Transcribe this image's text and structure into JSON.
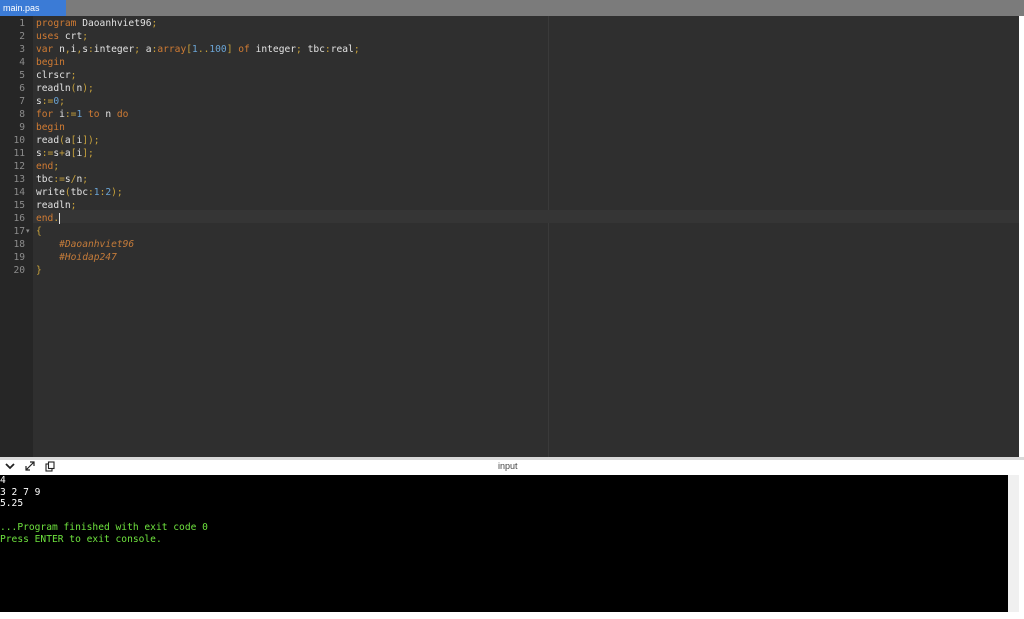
{
  "tab": {
    "label": "main.pas"
  },
  "editor": {
    "line_numbers": [
      "1",
      "2",
      "3",
      "4",
      "5",
      "6",
      "7",
      "8",
      "9",
      "10",
      "11",
      "12",
      "13",
      "14",
      "15",
      "16",
      "17",
      "18",
      "19",
      "20"
    ],
    "fold_marker": "▾",
    "lines": [
      [
        [
          "kw",
          "program "
        ],
        [
          "id",
          "Daoanhviet96"
        ],
        [
          "pu",
          ";"
        ]
      ],
      [
        [
          "kw",
          "uses "
        ],
        [
          "id",
          "crt"
        ],
        [
          "pu",
          ";"
        ]
      ],
      [
        [
          "kw",
          "var "
        ],
        [
          "id",
          "n"
        ],
        [
          "pu",
          ","
        ],
        [
          "id",
          "i"
        ],
        [
          "pu",
          ","
        ],
        [
          "id",
          "s"
        ],
        [
          "pu",
          ":"
        ],
        [
          "id",
          "integer"
        ],
        [
          "pu",
          "; "
        ],
        [
          "id",
          "a"
        ],
        [
          "pu",
          ":"
        ],
        [
          "kw",
          "array"
        ],
        [
          "pu",
          "["
        ],
        [
          "nm",
          "1"
        ],
        [
          "pu",
          ".."
        ],
        [
          "nm",
          "100"
        ],
        [
          "pu",
          "] "
        ],
        [
          "kw",
          "of "
        ],
        [
          "id",
          "integer"
        ],
        [
          "pu",
          "; "
        ],
        [
          "id",
          "tbc"
        ],
        [
          "pu",
          ":"
        ],
        [
          "id",
          "real"
        ],
        [
          "pu",
          ";"
        ]
      ],
      [
        [
          "kw",
          "begin"
        ]
      ],
      [
        [
          "id",
          "clrscr"
        ],
        [
          "pu",
          ";"
        ]
      ],
      [
        [
          "id",
          "readln"
        ],
        [
          "pu",
          "("
        ],
        [
          "id",
          "n"
        ],
        [
          "pu",
          ");"
        ]
      ],
      [
        [
          "id",
          "s"
        ],
        [
          "pu",
          ":="
        ],
        [
          "nm",
          "0"
        ],
        [
          "pu",
          ";"
        ]
      ],
      [
        [
          "kw",
          "for "
        ],
        [
          "id",
          "i"
        ],
        [
          "pu",
          ":="
        ],
        [
          "nm",
          "1"
        ],
        [
          "kw",
          " to "
        ],
        [
          "id",
          "n"
        ],
        [
          "kw",
          " do"
        ]
      ],
      [
        [
          "kw",
          "begin"
        ]
      ],
      [
        [
          "id",
          "read"
        ],
        [
          "pu",
          "("
        ],
        [
          "id",
          "a"
        ],
        [
          "pu",
          "["
        ],
        [
          "id",
          "i"
        ],
        [
          "pu",
          "]);"
        ]
      ],
      [
        [
          "id",
          "s"
        ],
        [
          "pu",
          ":="
        ],
        [
          "id",
          "s"
        ],
        [
          "pu",
          "+"
        ],
        [
          "id",
          "a"
        ],
        [
          "pu",
          "["
        ],
        [
          "id",
          "i"
        ],
        [
          "pu",
          "];"
        ]
      ],
      [
        [
          "kw",
          "end"
        ],
        [
          "pu",
          ";"
        ]
      ],
      [
        [
          "id",
          "tbc"
        ],
        [
          "pu",
          ":="
        ],
        [
          "id",
          "s"
        ],
        [
          "pu",
          "/"
        ],
        [
          "id",
          "n"
        ],
        [
          "pu",
          ";"
        ]
      ],
      [
        [
          "id",
          "write"
        ],
        [
          "pu",
          "("
        ],
        [
          "id",
          "tbc"
        ],
        [
          "pu",
          ":"
        ],
        [
          "nm",
          "1"
        ],
        [
          "pu",
          ":"
        ],
        [
          "nm",
          "2"
        ],
        [
          "pu",
          ");"
        ]
      ],
      [
        [
          "id",
          "readln"
        ],
        [
          "pu",
          ";"
        ]
      ],
      [
        [
          "kw",
          "end"
        ],
        [
          "pu",
          "."
        ]
      ],
      [
        [
          "pu",
          "{"
        ]
      ],
      [
        [
          "cm",
          "    #Daoanhviet96"
        ]
      ],
      [
        [
          "cm",
          "    #Hoidap247"
        ]
      ],
      [
        [
          "pu",
          "}"
        ]
      ]
    ]
  },
  "console": {
    "label": "input",
    "lines": [
      {
        "text": "4",
        "color": "white"
      },
      {
        "text": "3 2 7 9",
        "color": "white"
      },
      {
        "text": "5.25",
        "color": "white"
      },
      {
        "text": "",
        "color": "white"
      },
      {
        "text": "...Program finished with exit code 0",
        "color": "green"
      },
      {
        "text": "Press ENTER to exit console.",
        "color": "green"
      }
    ]
  },
  "icons": [
    "collapse-icon",
    "expand-icon",
    "copy-icon"
  ],
  "colors": {
    "tab_active": "#3b7bd6",
    "editor_bg": "#2f2f2f",
    "keyword": "#d07b33",
    "console_bg": "#000000",
    "console_green": "#6ee23e"
  }
}
